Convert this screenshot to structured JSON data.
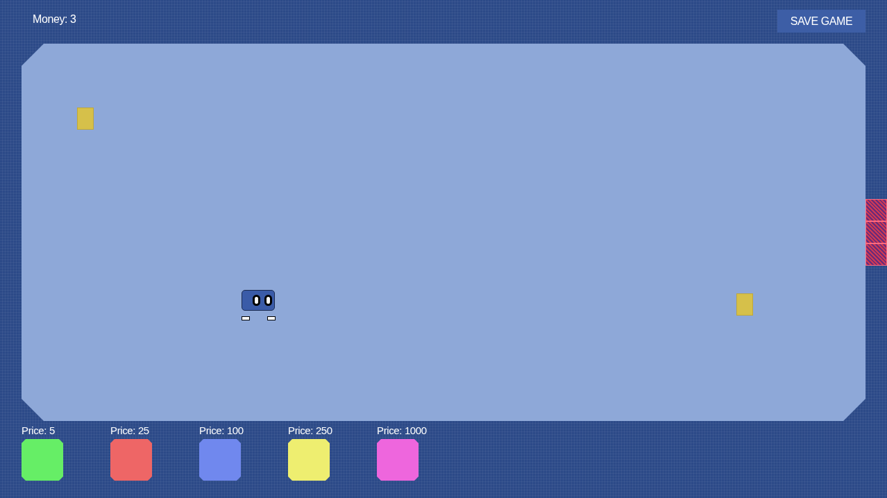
{
  "money": "Money: 3",
  "save_button": "SAVE GAME",
  "shop": [
    {
      "price": "Price: 5",
      "color": "#66ee66"
    },
    {
      "price": "Price: 25",
      "color": "#ee6666"
    },
    {
      "price": "Price: 100",
      "color": "#7088ee"
    },
    {
      "price": "Price: 250",
      "color": "#eeee70"
    },
    {
      "price": "Price: 1000",
      "color": "#ee66dd"
    }
  ]
}
